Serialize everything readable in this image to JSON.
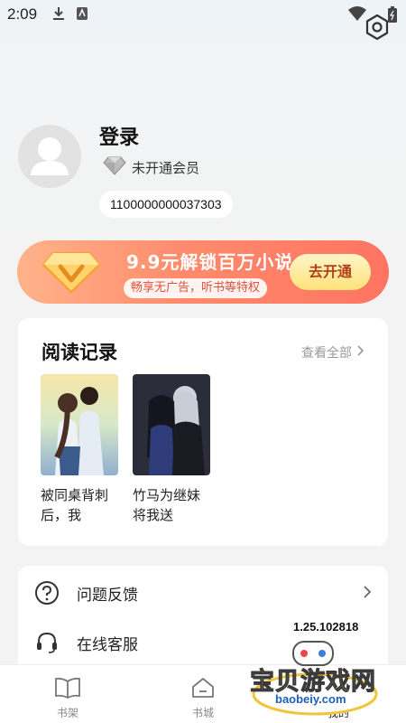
{
  "status_bar": {
    "time": "2:09"
  },
  "profile": {
    "login_label": "登录",
    "vip_status": "未开通会员",
    "user_id": "1100000000037303"
  },
  "vip_banner": {
    "title": "9.9元解锁百万小说",
    "subtitle": "畅享无广告，听书等特权",
    "button": "去开通"
  },
  "reading_history": {
    "title": "阅读记录",
    "view_all": "查看全部",
    "books": [
      {
        "title": "被同桌背刺后，我"
      },
      {
        "title": "竹马为继妹将我送"
      }
    ]
  },
  "menu": {
    "items": [
      {
        "label": "问题反馈",
        "icon": "question-circle-icon"
      },
      {
        "label": "在线客服",
        "icon": "headset-icon"
      }
    ],
    "version": "1.25.102818"
  },
  "tab_bar": {
    "tabs": [
      {
        "label": "书架",
        "icon": "book-icon"
      },
      {
        "label": "书城",
        "icon": "home-icon"
      },
      {
        "label": "我的",
        "icon": "user-icon"
      }
    ]
  },
  "watermark": {
    "text": "宝贝游戏网",
    "url": "baobeiy.com"
  },
  "colors": {
    "accent": "#ff7461",
    "banner_button": "#ffe27a",
    "banner_text": "#e0503b"
  }
}
